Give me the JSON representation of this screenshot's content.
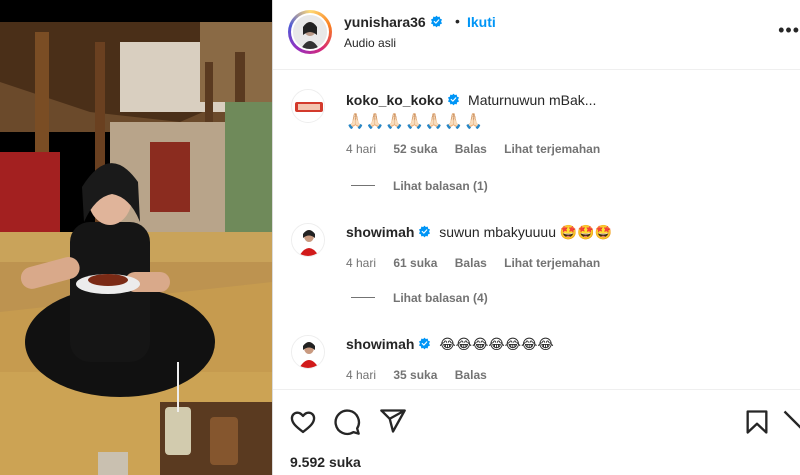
{
  "post": {
    "username": "yunishara36",
    "follow_label": "Ikuti",
    "audio": "Audio asli",
    "likes_count": "9.592",
    "likes_label": "suka"
  },
  "comments": [
    {
      "user": "koko_ko_koko",
      "text": "Maturnuwun mBak...",
      "emoji_line": "🙏🏻🙏🏻🙏🏻🙏🏻🙏🏻🙏🏻🙏🏻",
      "time": "4 hari",
      "likes": "52 suka",
      "reply": "Balas",
      "translate": "Lihat terjemahan",
      "view_replies": "Lihat balasan (1)"
    },
    {
      "user": "showimah",
      "text": "suwun mbakyuuuu",
      "emoji_line": "🤩🤩🤩",
      "time": "4 hari",
      "likes": "61 suka",
      "reply": "Balas",
      "translate": "Lihat terjemahan",
      "view_replies": "Lihat balasan (4)"
    },
    {
      "user": "showimah",
      "text": "",
      "emoji_line": "😂😂😂😂😂😂😂",
      "time": "4 hari",
      "likes": "35 suka",
      "reply": "Balas"
    }
  ],
  "icons": {
    "like": "heart-icon",
    "comment": "comment-icon",
    "share": "share-icon",
    "save": "bookmark-icon",
    "more": "more-icon",
    "verified": "verified-badge-icon"
  },
  "colors": {
    "link": "#0095f6",
    "verified": "#0095f6",
    "muted": "#737373",
    "text": "#262626"
  }
}
